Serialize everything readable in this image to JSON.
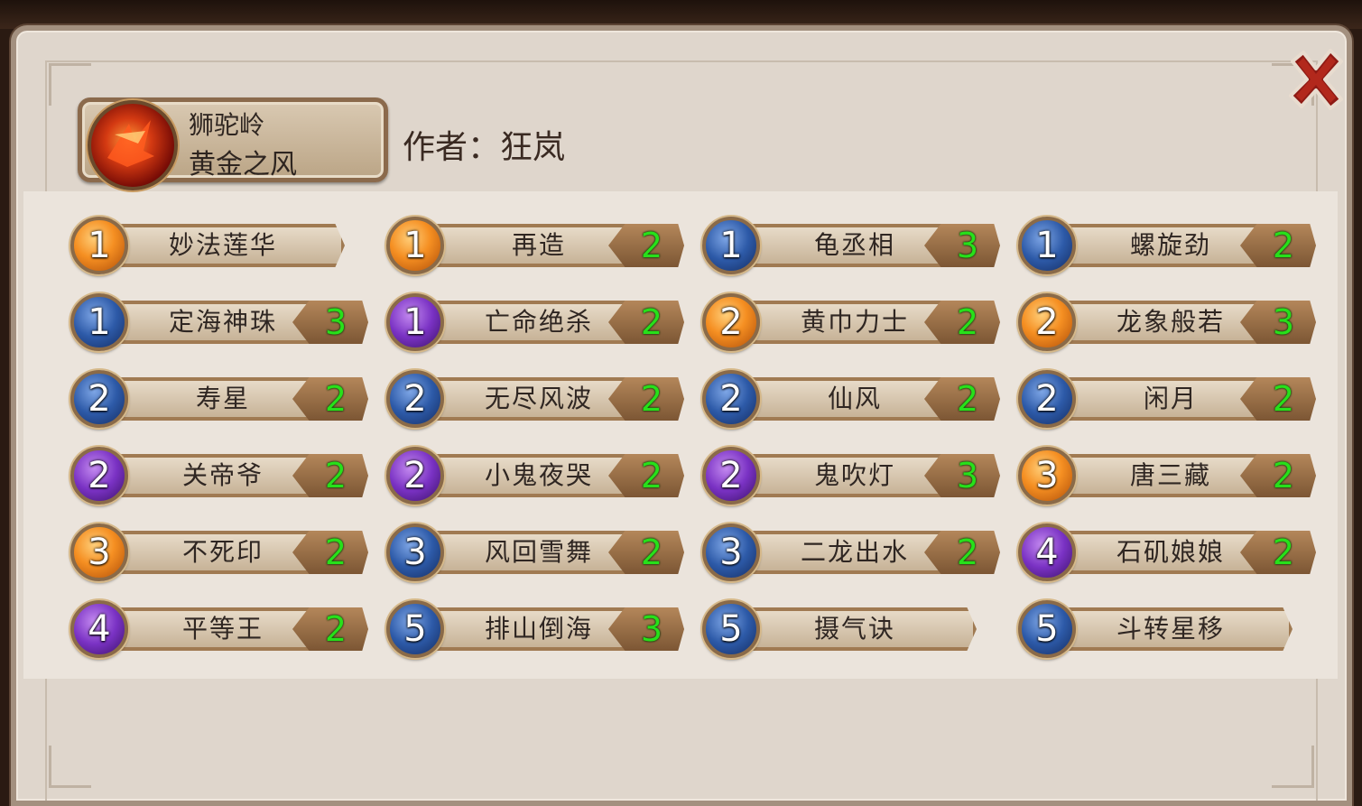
{
  "header": {
    "faction_name": "狮驼岭",
    "sect_name": "黄金之风",
    "author_text": "作者：狂岚"
  },
  "colors": {
    "count_text": "#27e01a",
    "level_orange": "#f58f22",
    "level_blue": "#2d5aa8",
    "level_purple": "#7a32c4"
  },
  "skills": [
    {
      "level": "1",
      "color": "orange",
      "name": "妙法莲华",
      "count": ""
    },
    {
      "level": "1",
      "color": "orange",
      "name": "再造",
      "count": "2"
    },
    {
      "level": "1",
      "color": "blue",
      "name": "龟丞相",
      "count": "3"
    },
    {
      "level": "1",
      "color": "blue",
      "name": "螺旋劲",
      "count": "2"
    },
    {
      "level": "1",
      "color": "blue",
      "name": "定海神珠",
      "count": "3"
    },
    {
      "level": "1",
      "color": "purple",
      "name": "亡命绝杀",
      "count": "2"
    },
    {
      "level": "2",
      "color": "orange",
      "name": "黄巾力士",
      "count": "2"
    },
    {
      "level": "2",
      "color": "orange",
      "name": "龙象般若",
      "count": "3"
    },
    {
      "level": "2",
      "color": "blue",
      "name": "寿星",
      "count": "2"
    },
    {
      "level": "2",
      "color": "blue",
      "name": "无尽风波",
      "count": "2"
    },
    {
      "level": "2",
      "color": "blue",
      "name": "仙风",
      "count": "2"
    },
    {
      "level": "2",
      "color": "blue",
      "name": "闲月",
      "count": "2"
    },
    {
      "level": "2",
      "color": "purple",
      "name": "关帝爷",
      "count": "2"
    },
    {
      "level": "2",
      "color": "purple",
      "name": "小鬼夜哭",
      "count": "2"
    },
    {
      "level": "2",
      "color": "purple",
      "name": "鬼吹灯",
      "count": "3"
    },
    {
      "level": "3",
      "color": "orange",
      "name": "唐三藏",
      "count": "2"
    },
    {
      "level": "3",
      "color": "orange",
      "name": "不死印",
      "count": "2"
    },
    {
      "level": "3",
      "color": "blue",
      "name": "风回雪舞",
      "count": "2"
    },
    {
      "level": "3",
      "color": "blue",
      "name": "二龙出水",
      "count": "2"
    },
    {
      "level": "4",
      "color": "purple",
      "name": "石矶娘娘",
      "count": "2"
    },
    {
      "level": "4",
      "color": "purple",
      "name": "平等王",
      "count": "2"
    },
    {
      "level": "5",
      "color": "blue",
      "name": "排山倒海",
      "count": "3"
    },
    {
      "level": "5",
      "color": "blue",
      "name": "摄气诀",
      "count": ""
    },
    {
      "level": "5",
      "color": "blue",
      "name": "斗转星移",
      "count": ""
    }
  ]
}
